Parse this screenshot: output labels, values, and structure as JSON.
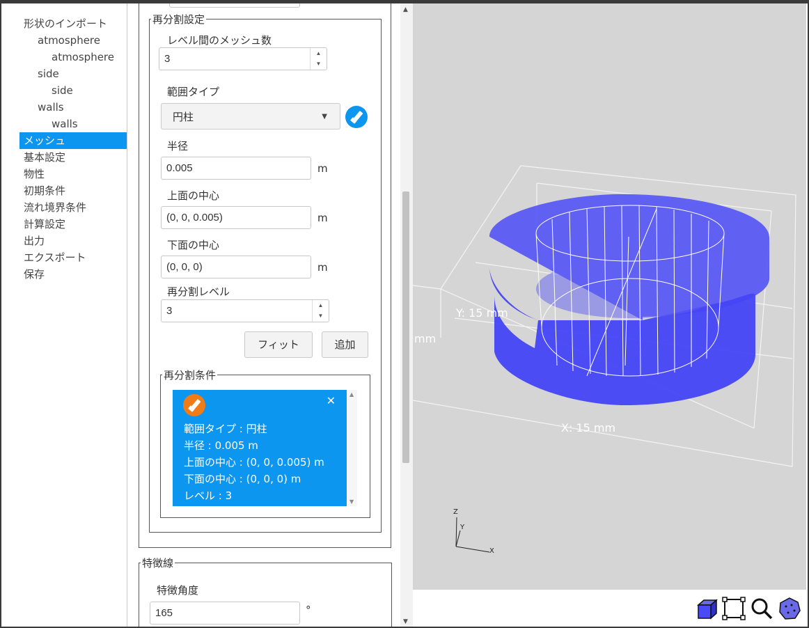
{
  "sidebar": {
    "items": [
      {
        "label": "形状のインポート",
        "level": 0
      },
      {
        "label": "atmosphere",
        "level": 1
      },
      {
        "label": "atmosphere",
        "level": 2
      },
      {
        "label": "side",
        "level": 1
      },
      {
        "label": "side",
        "level": 2
      },
      {
        "label": "walls",
        "level": 1
      },
      {
        "label": "walls",
        "level": 2
      },
      {
        "label": "メッシュ",
        "level": 0,
        "active": true
      },
      {
        "label": "基本設定",
        "level": 0
      },
      {
        "label": "物性",
        "level": 0
      },
      {
        "label": "初期条件",
        "level": 0
      },
      {
        "label": "流れ境界条件",
        "level": 0
      },
      {
        "label": "計算設定",
        "level": 0
      },
      {
        "label": "出力",
        "level": 0
      },
      {
        "label": "エクスポート",
        "level": 0
      },
      {
        "label": "保存",
        "level": 0
      }
    ]
  },
  "refine": {
    "legend": "再分割設定",
    "mesh_between_levels_label": "レベル間のメッシュ数",
    "mesh_between_levels_value": "3",
    "range_type_label": "範囲タイプ",
    "range_type_value": "円柱",
    "radius_label": "半径",
    "radius_value": "0.005",
    "radius_unit": "m",
    "top_center_label": "上面の中心",
    "top_center_value": "(0, 0, 0.005)",
    "top_center_unit": "m",
    "bottom_center_label": "下面の中心",
    "bottom_center_value": "(0, 0, 0)",
    "bottom_center_unit": "m",
    "level_label": "再分割レベル",
    "level_value": "3",
    "fit_button": "フィット",
    "add_button": "追加"
  },
  "conditions": {
    "legend": "再分割条件",
    "card_lines": [
      "範囲タイプ : 円柱",
      "半径 : 0.005 m",
      "上面の中心 : (0, 0, 0.005) m",
      "下面の中心 : (0, 0, 0) m",
      "レベル : 3"
    ]
  },
  "feature": {
    "legend": "特徴線",
    "angle_label": "特徴角度",
    "angle_value": "165",
    "angle_unit": "°"
  },
  "viewport": {
    "y_label": "Y: 15 mm",
    "x_label": "X: 15 mm",
    "left_partial": "mm",
    "axes": {
      "z": "Z",
      "y": "Y",
      "x": "X"
    }
  },
  "colors": {
    "accent": "#0c96f0",
    "orange": "#f07c18",
    "cylinder": "#4a4af8",
    "viewport_bg": "#d5d5d5"
  },
  "toolbar": {
    "icons": [
      "cube-view-icon",
      "fit-frame-icon",
      "zoom-icon",
      "mesh-sphere-icon"
    ]
  }
}
